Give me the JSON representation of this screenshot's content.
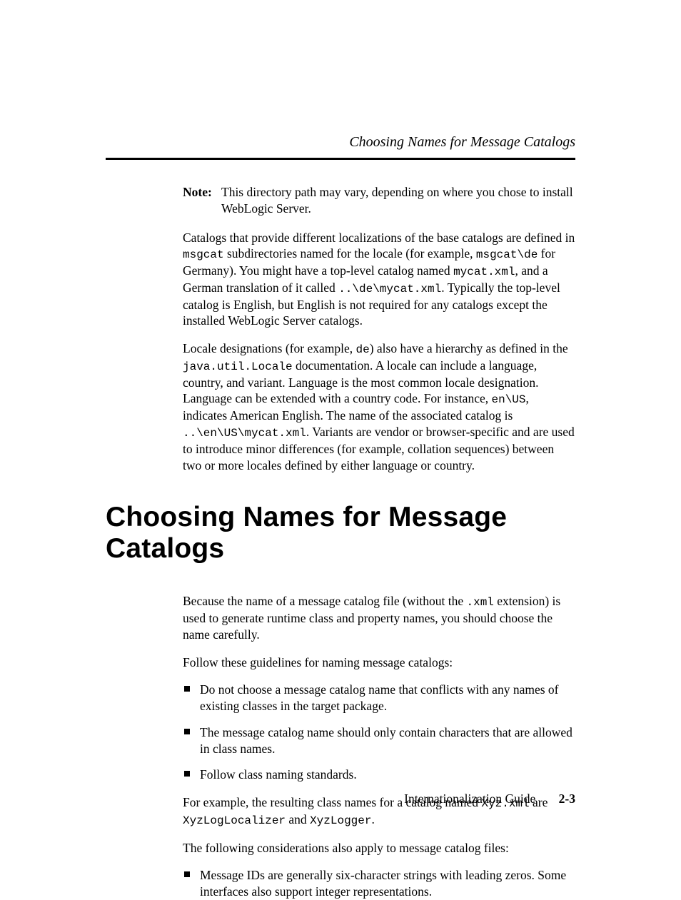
{
  "header": {
    "running_title": "Choosing Names for Message Catalogs"
  },
  "note": {
    "label": "Note:",
    "text": "This directory path may vary, depending on where you chose to install WebLogic Server."
  },
  "paragraphs": {
    "p1": {
      "a": " Catalogs that provide different localizations of the base catalogs are defined in ",
      "code1": "msgcat",
      "b": " subdirectories named for the locale (for example, ",
      "code2": "msgcat\\de",
      "c": " for Germany). You might have a top-level catalog named ",
      "code3": "mycat.xml",
      "d": ", and a German translation of it called ",
      "code4": "..\\de\\mycat.xml",
      "e": ". Typically the top-level catalog is English, but English is not required for any catalogs except the installed WebLogic Server catalogs."
    },
    "p2": {
      "a": "Locale designations (for example, ",
      "code1": "de",
      "b": ") also have a hierarchy as defined in the ",
      "code2": "java.util.Locale",
      "c": " documentation. A locale can include a language, country, and variant. Language is the most common locale designation. Language can be extended with a country code. For instance, ",
      "code3": "en\\US",
      "d": ", indicates American English. The name of the associated catalog is ",
      "code4": "..\\en\\US\\mycat.xml",
      "e": ". Variants are vendor or browser-specific and are used to introduce minor differences (for example, collation sequences) between two or more locales defined by either language or country."
    }
  },
  "section": {
    "title": "Choosing Names for Message Catalogs",
    "intro": {
      "a": "Because the name of a message catalog file (without the ",
      "code1": ".xml",
      "b": " extension) is used to generate runtime class and property names, you should choose the name carefully."
    },
    "lead": "Follow these guidelines for naming message catalogs:",
    "bullets1": [
      "Do not choose a message catalog name that conflicts with any names of existing classes in the target package.",
      "The message catalog name should only contain characters that are allowed in class names.",
      "Follow class naming standards."
    ],
    "example_para": {
      "a": "For example, the resulting class names for a catalog named ",
      "code1": "Xyz.xml",
      "b": " are ",
      "code2": "XyzLogLocalizer",
      "c": " and ",
      "code3": "XyzLogger",
      "d": "."
    },
    "lead2": "The following considerations also apply to message catalog files:",
    "bullets2": [
      "Message IDs are generally six-character strings with leading zeros. Some interfaces also support integer representations."
    ]
  },
  "footer": {
    "book": "Internationalization Guide",
    "page": "2-3"
  }
}
